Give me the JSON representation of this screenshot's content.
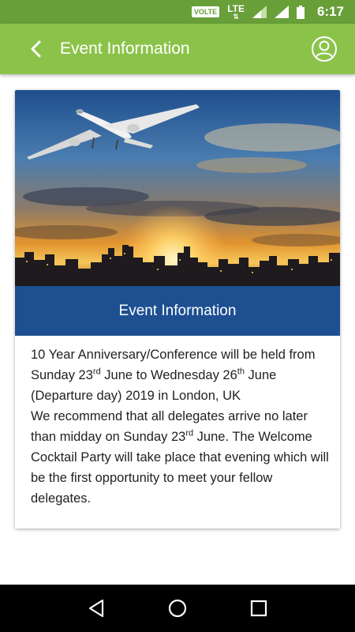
{
  "status_bar": {
    "volte": "VOLTE",
    "lte": "LTE",
    "time": "6:17"
  },
  "app_bar": {
    "title": "Event Information",
    "back_icon": "back-arrow-icon",
    "profile_icon": "account-circle-icon"
  },
  "card": {
    "header_title": "Event Information",
    "hero_image": "airplane-over-city-sunset",
    "paragraph1": {
      "part1": "10 Year Anniversary/Conference will be held from Sunday 23",
      "sup1": "rd",
      "part2": " June to Wednesday 26",
      "sup2": "th",
      "part3": " June (Departure day) 2019 in London, UK"
    },
    "paragraph2": {
      "part1": "We recommend that all delegates arrive no later than midday on Sunday 23",
      "sup1": "rd",
      "part2": " June. The Welcome Cocktail Party will take place that evening which will be the first opportunity to meet your fellow delegates."
    }
  },
  "nav_bar": {
    "back": "nav-back-icon",
    "home": "nav-home-icon",
    "recents": "nav-recents-icon"
  },
  "colors": {
    "status_bar": "#689f38",
    "app_bar": "#8bc34a",
    "card_header": "#1d4f91"
  }
}
